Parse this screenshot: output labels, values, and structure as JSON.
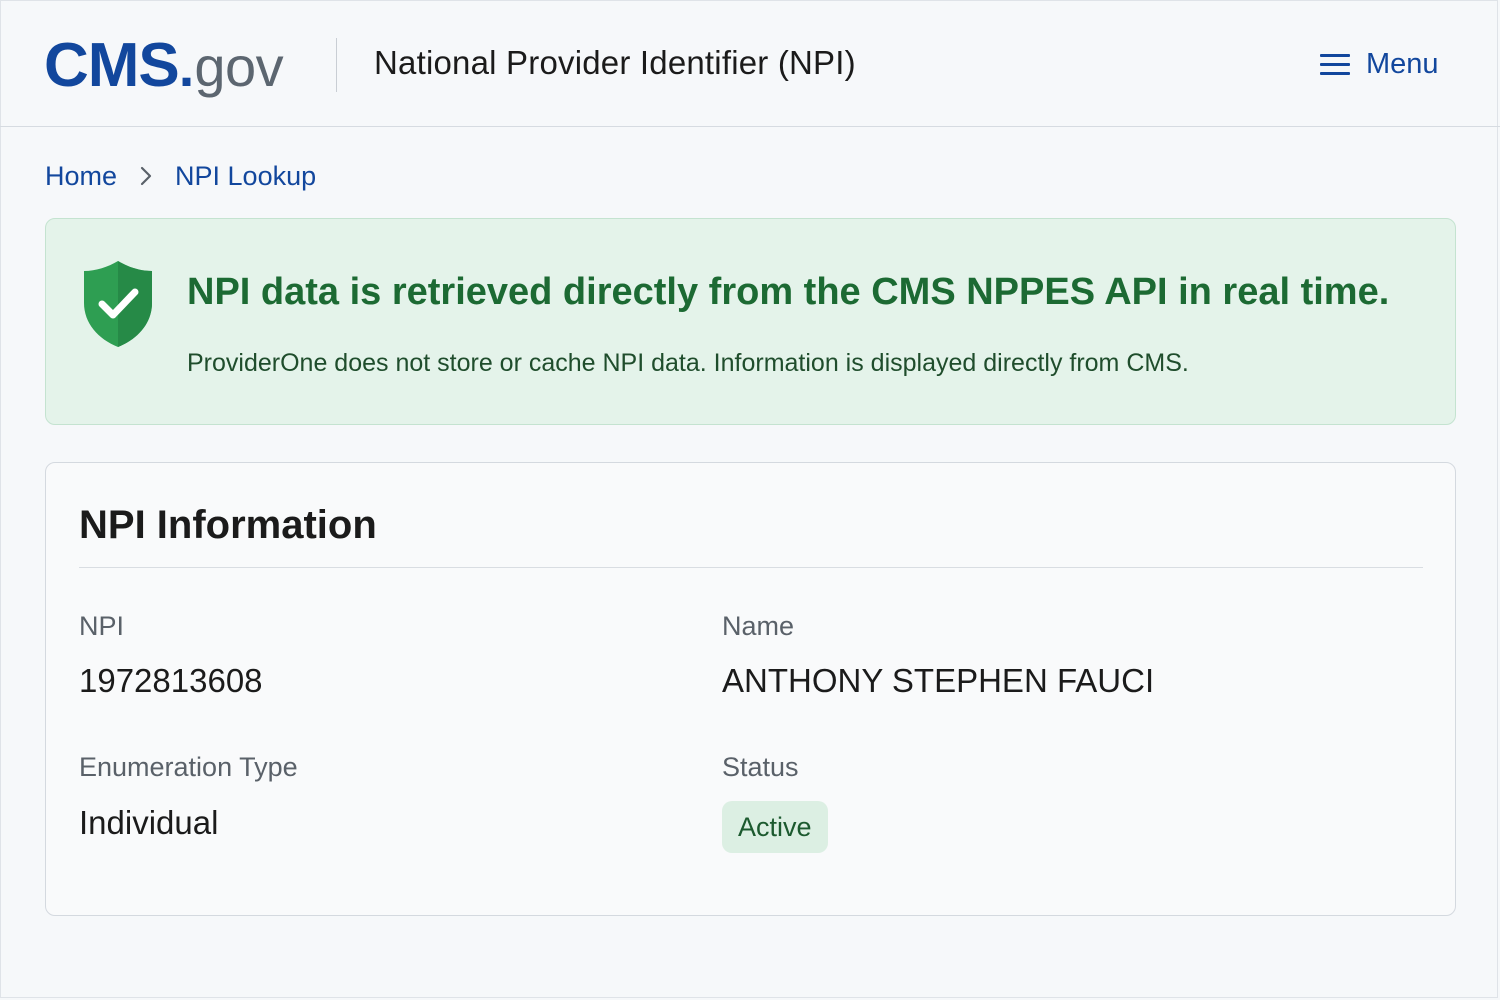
{
  "header": {
    "logo_primary": "CMS",
    "logo_dot": ".",
    "logo_suffix": "gov",
    "title": "National Provider Identifier (NPI)",
    "menu_label": "Menu",
    "menu_icon": "hamburger-icon"
  },
  "breadcrumb": {
    "items": [
      {
        "label": "Home"
      },
      {
        "label": "NPI Lookup"
      }
    ],
    "separator_icon": "chevron-right-icon"
  },
  "alert": {
    "icon": "shield-check-icon",
    "title": "NPI data is retrieved directly from the CMS NPPES API in real time.",
    "message": "ProviderOne does not store or cache NPI data. Information is displayed directly from CMS."
  },
  "npi_card": {
    "title": "NPI Information",
    "fields": {
      "npi": {
        "label": "NPI",
        "value": "1972813608"
      },
      "name": {
        "label": "Name",
        "value": "ANTHONY STEPHEN FAUCI"
      },
      "enumeration_type": {
        "label": "Enumeration Type",
        "value": "Individual"
      },
      "status": {
        "label": "Status",
        "value": "Active"
      }
    }
  },
  "colors": {
    "brand_blue": "#12479d",
    "alert_background": "#e4f3ea",
    "alert_title": "#1c6a33",
    "shield_green": "#2e9e52",
    "badge_background": "#dcefe3"
  }
}
